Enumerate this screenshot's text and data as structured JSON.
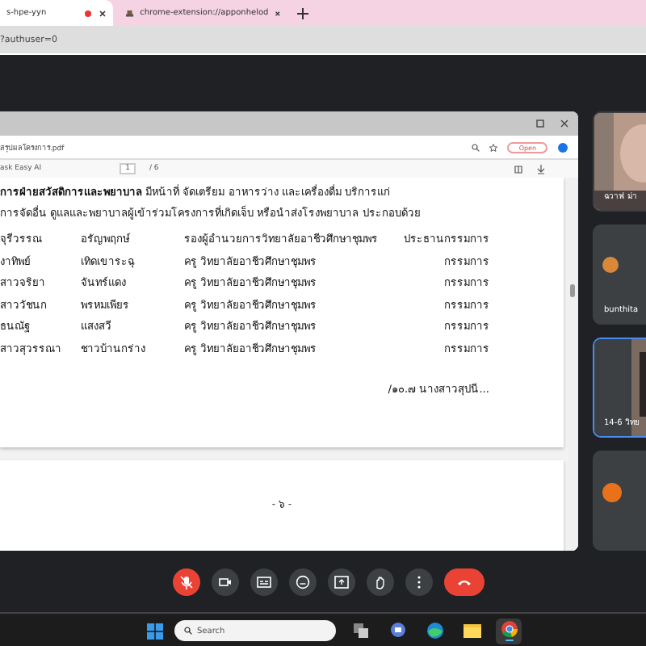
{
  "browser": {
    "tabs": [
      {
        "label": "s-hpe-yyn",
        "selected": true
      },
      {
        "label": "chrome-extension://apponhelod",
        "selected": false
      }
    ],
    "address": "?authuser=0"
  },
  "shared_window": {
    "url": "สรุปผลโครงการ.pdf",
    "open_badge": "Open",
    "pdf_toolbar": {
      "title": "ask Easy AI",
      "page": "1",
      "total": "/ 6"
    },
    "document": {
      "paragraph_lead": "การฝ่ายสวัสดิการและพยาบาล",
      "paragraph": " มีหน้าที่  จัดเตรียม อาหารว่าง และเครื่องดื่ม บริการแก่",
      "paragraph_2": "การจัดอื่น ดูแลและพยาบาลผู้เข้าร่วมโครงการที่เกิดเจ็บ หรือนำส่งโรงพยาบาล ประกอบด้วย",
      "rows": [
        {
          "first": "จุรีวรรณ",
          "last": "อรัญพฤกษ์",
          "position": "รองผู้อำนวยการวิทยาลัยอาชีวศึกษาชุมพร",
          "role": "ประธานกรรมการ"
        },
        {
          "first": "งาทิพย์",
          "last": "เทิดเขาระฉุ",
          "position": "ครู วิทยาลัยอาชีวศึกษาชุมพร",
          "role": "กรรมการ"
        },
        {
          "first": "สาวจริยา",
          "last": "จันทร์แดง",
          "position": "ครู วิทยาลัยอาชีวศึกษาชุมพร",
          "role": "กรรมการ"
        },
        {
          "first": "สาววัชนก",
          "last": "พรหมเพียร",
          "position": "ครู วิทยาลัยอาชีวศึกษาชุมพร",
          "role": "กรรมการ"
        },
        {
          "first": "ธนณัฐ",
          "last": "แสงสวี",
          "position": "ครู วิทยาลัยอาชีวศึกษาชุมพร",
          "role": "กรรมการ"
        },
        {
          "first": "สาวสุวรรณา",
          "last": "ชาวบ้านกร่าง",
          "position": "ครู วิทยาลัยอาชีวศึกษาชุมพร",
          "role": "กรรมการ"
        }
      ],
      "continuation": "/๑๐.๗ นางสาวสุปนี...",
      "page_number": "- ๖ -"
    }
  },
  "participants": [
    {
      "name": "ฉวาฟ ม่า",
      "kind": "video",
      "selected": false
    },
    {
      "name": "bunthita",
      "kind": "avatar",
      "selected": false
    },
    {
      "name": "14-6 วิทย",
      "kind": "video",
      "selected": true
    },
    {
      "kind": "initial",
      "selected": false
    }
  ],
  "controls": [
    {
      "kind": "mic",
      "muted": true
    },
    {
      "kind": "camera"
    },
    {
      "kind": "captions"
    },
    {
      "kind": "emoji"
    },
    {
      "kind": "present"
    },
    {
      "kind": "hand"
    },
    {
      "kind": "more"
    },
    {
      "kind": "hangup"
    }
  ],
  "taskbar": {
    "search_placeholder": "Search",
    "apps": [
      {
        "kind": "taskview",
        "active": false
      },
      {
        "kind": "chat",
        "active": false
      },
      {
        "kind": "edge",
        "active": false
      },
      {
        "kind": "folder",
        "active": false
      },
      {
        "kind": "chrome",
        "active": true
      }
    ]
  }
}
